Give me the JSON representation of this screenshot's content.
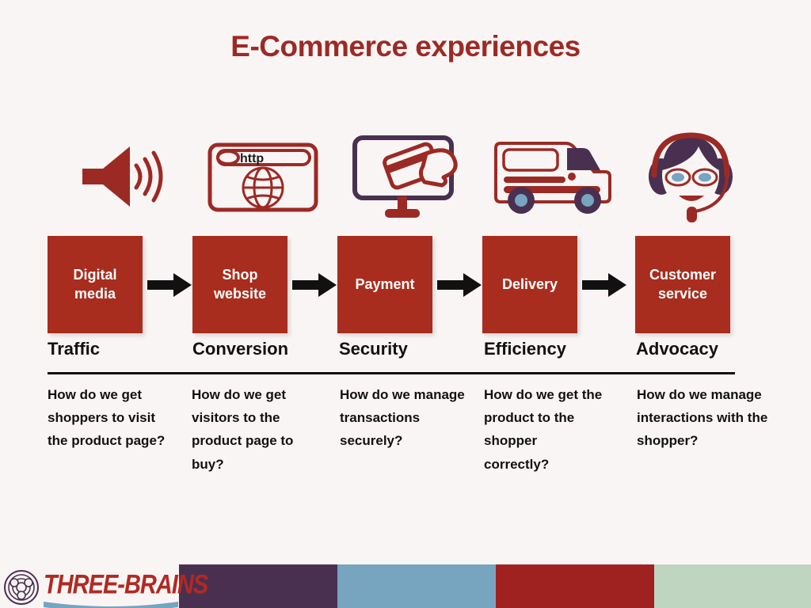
{
  "slide": {
    "title": "E-Commerce experiences",
    "background_color": "#faf5f5",
    "title_color": "#9c2a24"
  },
  "theme": {
    "box_color": "#a82d1e",
    "box_text_color": "#ffffff",
    "arrow_color": "#111111",
    "icon_red": "#9c2a24",
    "icon_purple": "#4a3050",
    "icon_blue": "#77a4bf",
    "label_color": "#111111"
  },
  "stages": [
    {
      "icon": "megaphone-icon",
      "box_label": "Digital media",
      "category": "Traffic",
      "question": "How do we get shoppers to visit the product page?"
    },
    {
      "icon": "browser-globe-icon",
      "box_label": "Shop website",
      "category": "Conversion",
      "question": "How do we get visitors to the product page to buy?"
    },
    {
      "icon": "monitor-card-payment-icon",
      "box_label": "Payment",
      "category": "Security",
      "question": "How do we manage transactions securely?"
    },
    {
      "icon": "delivery-van-icon",
      "box_label": "Delivery",
      "category": "Efficiency",
      "question": "How do we get the product to the shopper correctly?"
    },
    {
      "icon": "headset-agent-icon",
      "box_label": "Customer service",
      "category": "Advocacy",
      "question": "How do we manage interactions with the shopper?"
    }
  ],
  "arrows": [
    {
      "name": "arrow-right-icon"
    },
    {
      "name": "arrow-right-icon"
    },
    {
      "name": "arrow-right-icon"
    },
    {
      "name": "arrow-right-icon"
    }
  ],
  "browser_icon": {
    "url_text": "http"
  },
  "footer": {
    "logo_text": "THREE-BRAINS",
    "logo_mark": "brain-network-icon",
    "bars": [
      {
        "name": "color-bar-purple",
        "color": "#4a3050"
      },
      {
        "name": "color-bar-blue",
        "color": "#77a4bf"
      },
      {
        "name": "color-bar-red",
        "color": "#a02220"
      },
      {
        "name": "color-bar-green",
        "color": "#bfd5c0"
      }
    ]
  }
}
